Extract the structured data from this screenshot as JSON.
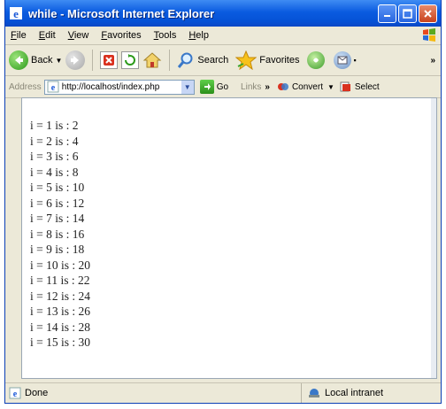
{
  "window": {
    "title": "while - Microsoft Internet Explorer"
  },
  "menubar": {
    "items": [
      "File",
      "Edit",
      "View",
      "Favorites",
      "Tools",
      "Help"
    ]
  },
  "toolbar": {
    "back_label": "Back",
    "search_label": "Search",
    "favorites_label": "Favorites"
  },
  "address_bar": {
    "label": "Address",
    "url": "http://localhost/index.php",
    "go_label": "Go",
    "links_label": "Links",
    "convert_label": "Convert",
    "select_label": "Select"
  },
  "content": {
    "lines": [
      "i = 1 is : 2",
      "i = 2 is : 4",
      "i = 3 is : 6",
      "i = 4 is : 8",
      "i = 5 is : 10",
      "i = 6 is : 12",
      "i = 7 is : 14",
      "i = 8 is : 16",
      "i = 9 is : 18",
      "i = 10 is : 20",
      "i = 11 is : 22",
      "i = 12 is : 24",
      "i = 13 is : 26",
      "i = 14 is : 28",
      "i = 15 is : 30"
    ]
  },
  "statusbar": {
    "status": "Done",
    "zone": "Local intranet"
  },
  "colors": {
    "titlebar": "#0552d6",
    "chrome": "#ece9d8"
  }
}
